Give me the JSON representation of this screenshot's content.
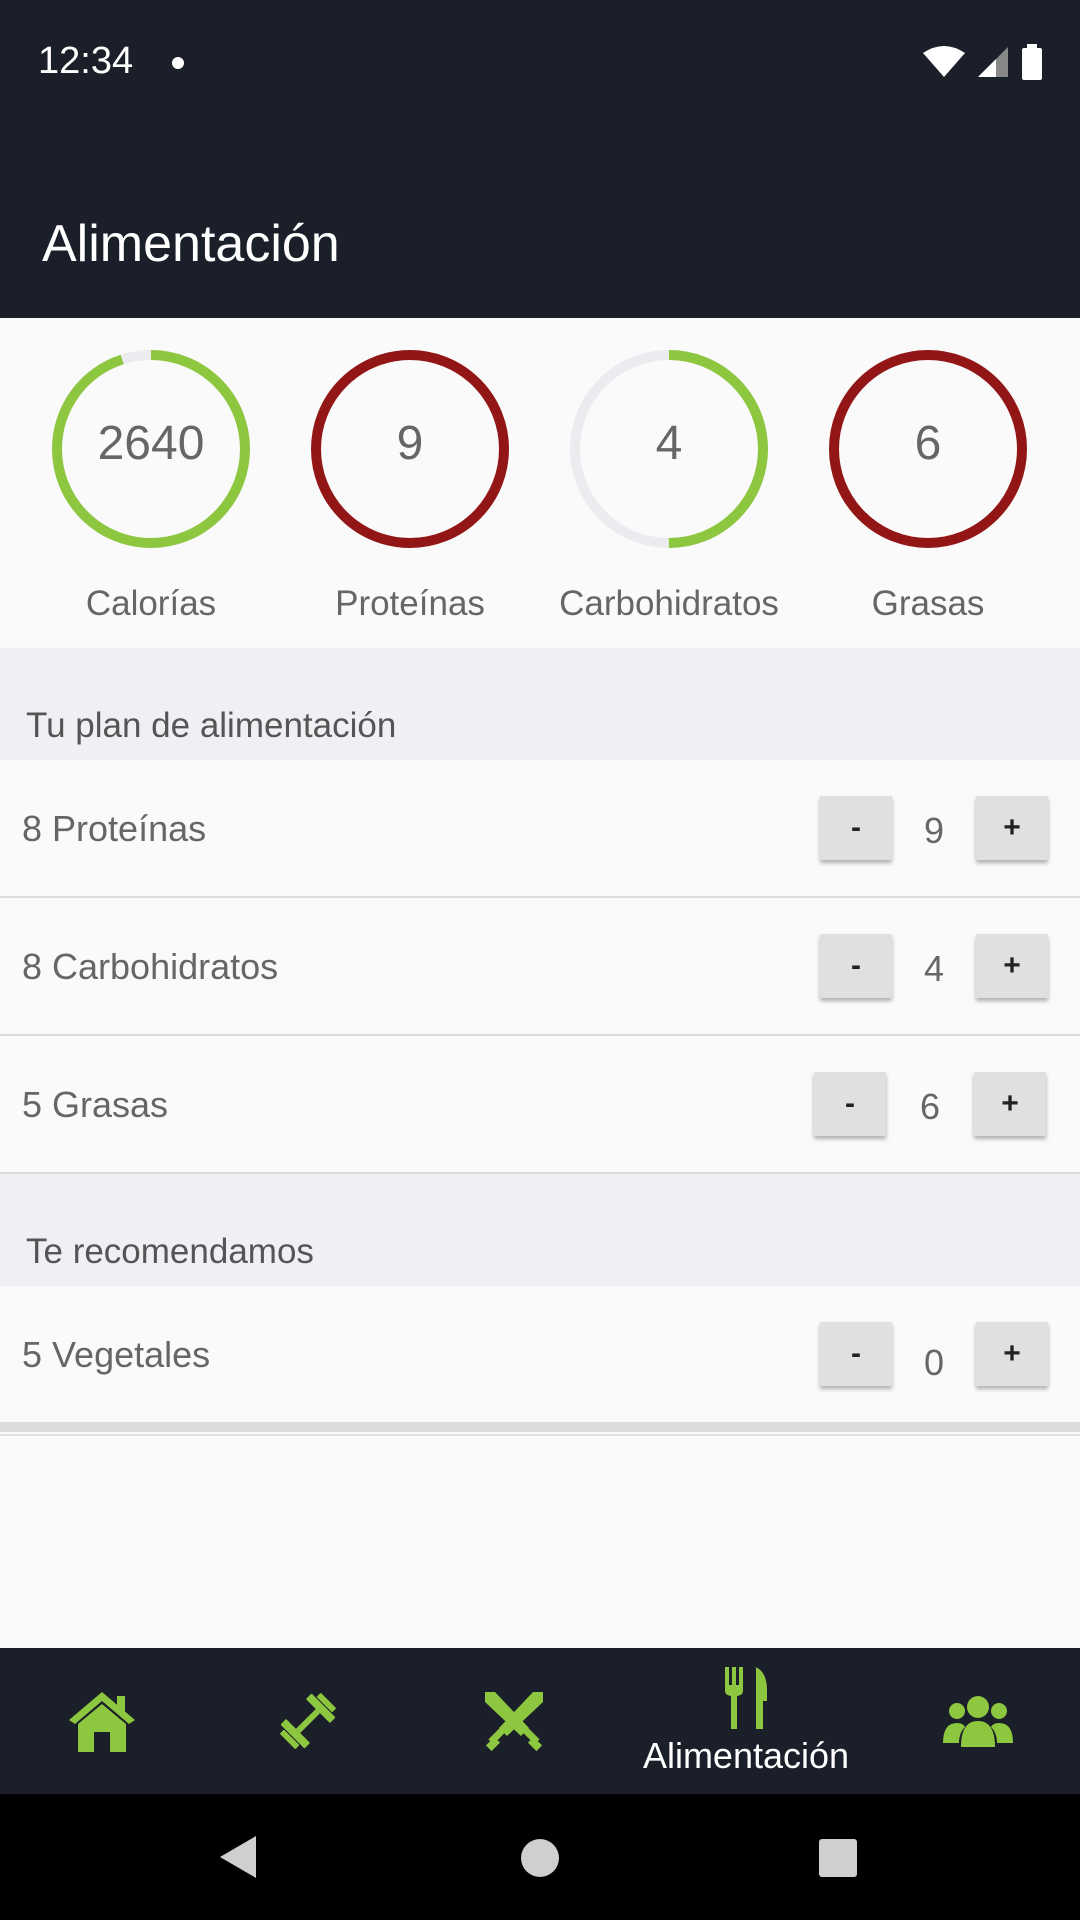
{
  "status_bar": {
    "time": "12:34"
  },
  "app_bar": {
    "title": "Alimentación"
  },
  "summary": [
    {
      "value": "2640",
      "label": "Calorías",
      "progress": 0.95,
      "color": "#8dc63f"
    },
    {
      "value": "9",
      "label": "Proteínas",
      "progress": 1.0,
      "color": "#931616"
    },
    {
      "value": "4",
      "label": "Carbohidratos",
      "progress": 0.5,
      "color": "#8dc63f"
    },
    {
      "value": "6",
      "label": "Grasas",
      "progress": 1.0,
      "color": "#931616"
    }
  ],
  "plan": {
    "header": "Tu plan de alimentación",
    "items": [
      {
        "name": "8 Proteínas",
        "count": "9",
        "minus": "-",
        "plus": "+"
      },
      {
        "name": "8 Carbohidratos",
        "count": "4",
        "minus": "-",
        "plus": "+"
      },
      {
        "name": "5 Grasas",
        "count": "6",
        "minus": "-",
        "plus": "+"
      }
    ]
  },
  "recommend": {
    "header": "Te recomendamos",
    "items": [
      {
        "name": "5 Vegetales",
        "count": "0",
        "minus": "-",
        "plus": "+"
      }
    ]
  },
  "bottom_nav": {
    "items": [
      {
        "icon": "home-icon"
      },
      {
        "icon": "dumbbell-icon"
      },
      {
        "icon": "crossed-swords-icon"
      },
      {
        "icon": "fork-knife-icon",
        "label": "Alimentación",
        "active": true
      },
      {
        "icon": "group-icon"
      }
    ]
  },
  "colors": {
    "accent": "#8dc63f",
    "over": "#931616",
    "dark": "#1a1f29"
  }
}
